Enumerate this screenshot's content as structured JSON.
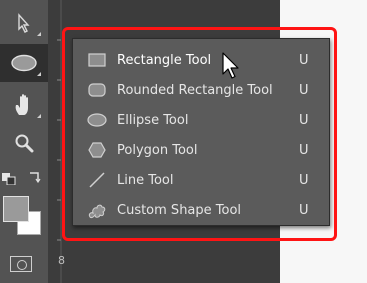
{
  "toolbar": {
    "tools": [
      {
        "name": "path-selection-icon"
      },
      {
        "name": "ellipse-icon"
      },
      {
        "name": "hand-icon"
      },
      {
        "name": "zoom-icon"
      }
    ],
    "ruler_label": "8"
  },
  "flyout": {
    "items": [
      {
        "icon": "rectangle-icon",
        "label": "Rectangle Tool",
        "shortcut": "U"
      },
      {
        "icon": "rounded-rectangle-icon",
        "label": "Rounded Rectangle Tool",
        "shortcut": "U"
      },
      {
        "icon": "ellipse-icon",
        "label": "Ellipse Tool",
        "shortcut": "U"
      },
      {
        "icon": "polygon-icon",
        "label": "Polygon Tool",
        "shortcut": "U"
      },
      {
        "icon": "line-icon",
        "label": "Line Tool",
        "shortcut": "U"
      },
      {
        "icon": "custom-shape-icon",
        "label": "Custom Shape Tool",
        "shortcut": "U"
      }
    ]
  },
  "colors": {
    "highlight": "#ff1414",
    "toolbar": "#535353",
    "flyout": "#5b5b5b"
  }
}
